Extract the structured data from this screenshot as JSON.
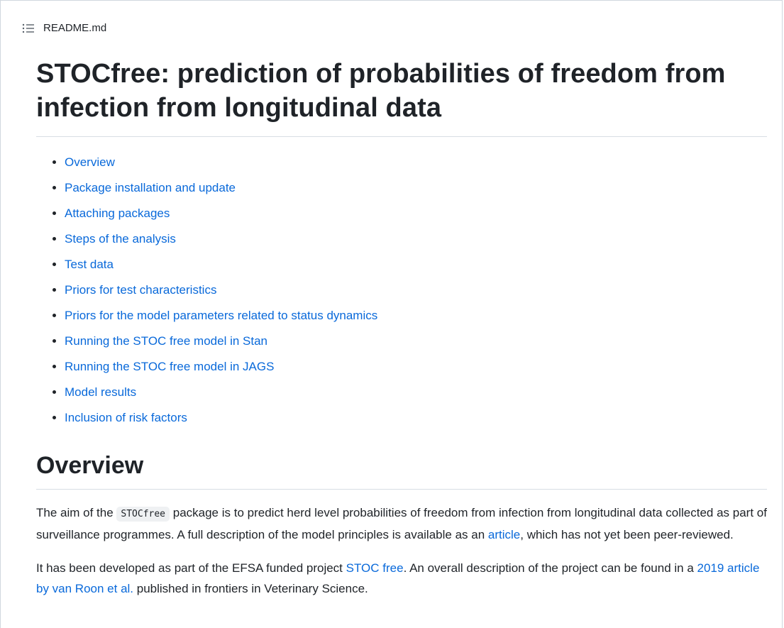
{
  "header": {
    "icon": "list-toc-icon",
    "file_name": "README.md"
  },
  "readme": {
    "title": "STOCfree: prediction of probabilities of freedom from infection from longitudinal data",
    "toc": [
      "Overview",
      "Package installation and update",
      "Attaching packages",
      "Steps of the analysis",
      "Test data",
      "Priors for test characteristics",
      "Priors for the model parameters related to status dynamics",
      "Running the STOC free model in Stan",
      "Running the STOC free model in JAGS",
      "Model results",
      "Inclusion of risk factors"
    ],
    "overview": {
      "heading": "Overview",
      "p1": {
        "before_code": "The aim of the ",
        "code": "STOCfree",
        "after_code": " package is to predict herd level probabilities of freedom from infection from longitudinal data collected as part of surveillance programmes. A full description of the model principles is available as an ",
        "link": "article",
        "after_link": ", which has not yet been peer-reviewed."
      },
      "p2": {
        "before_link1": "It has been developed as part of the EFSA funded project ",
        "link1": "STOC free",
        "between": ". An overall description of the project can be found in a ",
        "link2": "2019 article by van Roon et al.",
        "after_link2": " published in frontiers in Veterinary Science."
      }
    }
  },
  "colors": {
    "link": "#0969da",
    "text": "#1f2328",
    "border": "#d0d7de"
  }
}
